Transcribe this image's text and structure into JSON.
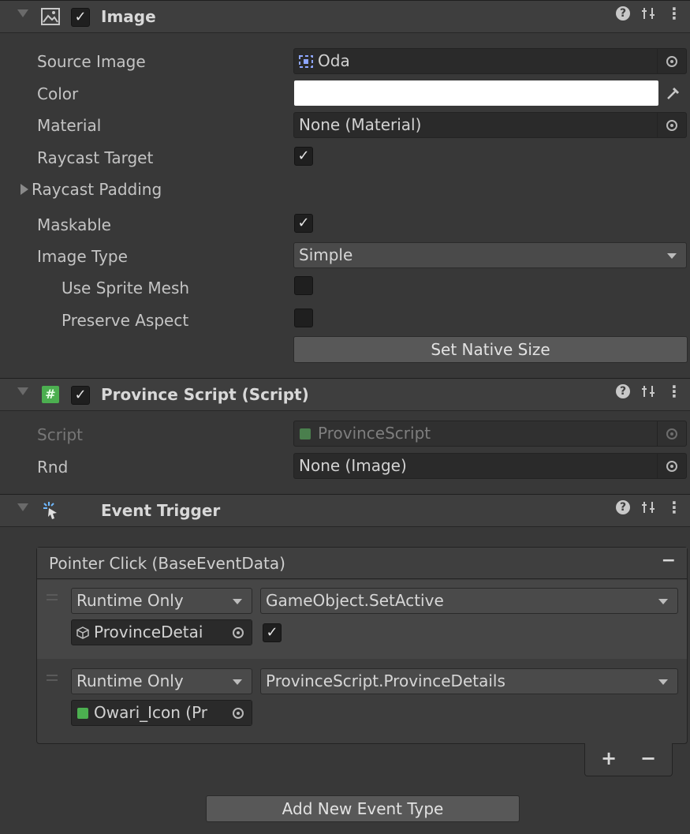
{
  "image_component": {
    "title": "Image",
    "enabled": true,
    "source_image": {
      "label": "Source Image",
      "value": "Oda"
    },
    "color": {
      "label": "Color",
      "value": "#ffffff"
    },
    "material": {
      "label": "Material",
      "value": "None (Material)"
    },
    "raycast_target": {
      "label": "Raycast Target",
      "checked": true
    },
    "raycast_padding": {
      "label": "Raycast Padding"
    },
    "maskable": {
      "label": "Maskable",
      "checked": true
    },
    "image_type": {
      "label": "Image Type",
      "value": "Simple"
    },
    "use_sprite_mesh": {
      "label": "Use Sprite Mesh",
      "checked": false
    },
    "preserve_aspect": {
      "label": "Preserve Aspect",
      "checked": false
    },
    "set_native_size_label": "Set Native Size"
  },
  "province_script_component": {
    "title": "Province Script (Script)",
    "enabled": true,
    "script": {
      "label": "Script",
      "value": "ProvinceScript"
    },
    "rnd": {
      "label": "Rnd",
      "value": "None (Image)"
    }
  },
  "event_trigger_component": {
    "title": "Event Trigger",
    "event_header": "Pointer Click (BaseEventData)",
    "minus_label": "−",
    "listeners": [
      {
        "mode": "Runtime Only",
        "function": "GameObject.SetActive",
        "target": "ProvinceDetai",
        "bool_arg": true
      },
      {
        "mode": "Runtime Only",
        "function": "ProvinceScript.ProvinceDetails",
        "target": "Owari_Icon (Pr"
      }
    ],
    "add_label": "+",
    "remove_label": "−",
    "add_event_type_label": "Add New Event Type"
  },
  "colors": {
    "background": "#383838",
    "header": "#3e3e3e",
    "field": "#2a2a2a",
    "check_green": "#4caf50"
  },
  "icons": {
    "help": "?",
    "kebab": "⋮",
    "check": "✓"
  }
}
